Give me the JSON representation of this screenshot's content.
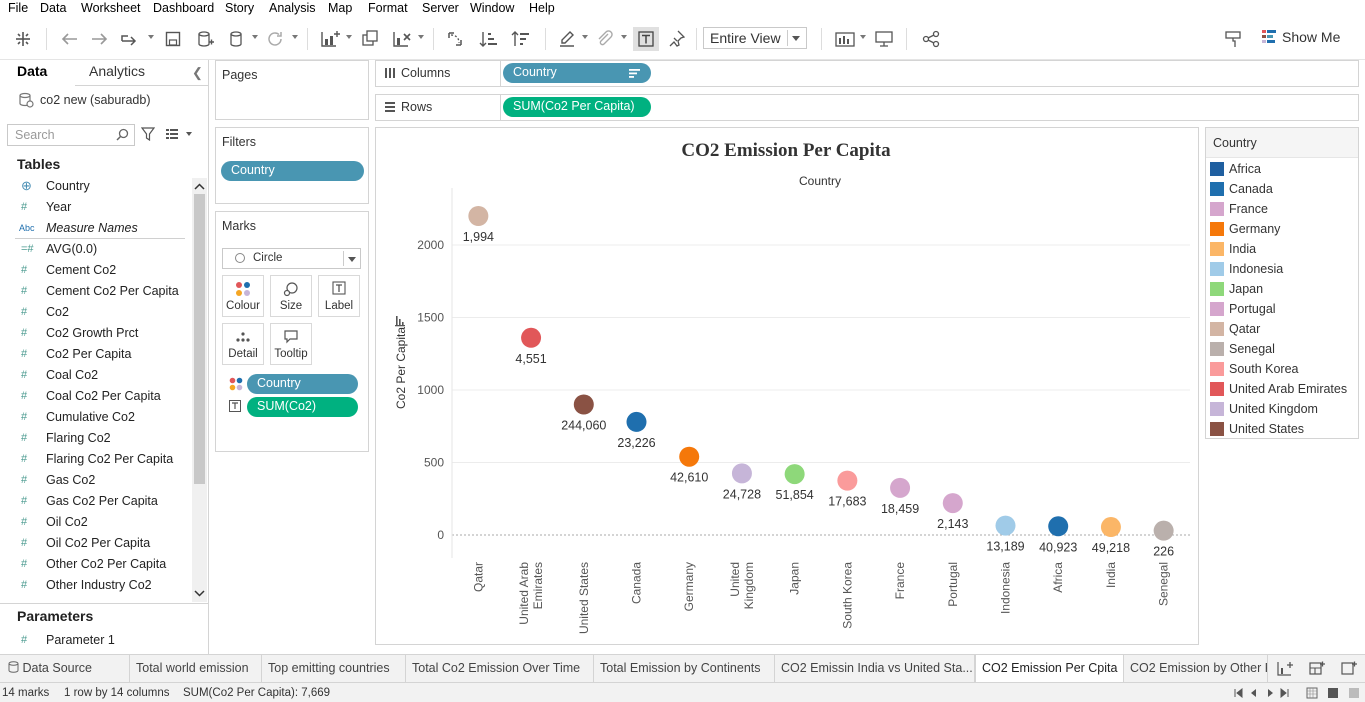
{
  "menu": [
    "File",
    "Data",
    "Worksheet",
    "Dashboard",
    "Story",
    "Analysis",
    "Map",
    "Format",
    "Server",
    "Window",
    "Help"
  ],
  "toolbar": {
    "view_select": "Entire View",
    "show_me": "Show Me",
    "icons": [
      "tableau-logo-icon",
      "undo-icon",
      "redo-icon",
      "replay-icon",
      "save-icon",
      "new-datasource-icon",
      "pause-update-icon",
      "refresh-icon",
      "new-worksheet-icon",
      "duplicate-sheet-icon",
      "clear-sheet-icon",
      "swap-icon",
      "sort-ascending-icon",
      "sort-descending-icon",
      "highlight-icon",
      "group-icon",
      "show-labels-icon",
      "pin-icon",
      "show-cards-icon",
      "presentation-icon",
      "share-icon",
      "format-icon"
    ]
  },
  "data_pane": {
    "tab_data": "Data",
    "tab_analytics": "Analytics",
    "datasource": "co2 new (saburadb)",
    "search_placeholder": "Search",
    "tables_heading": "Tables",
    "fields": [
      {
        "glyph": "⊕",
        "name": "Country",
        "italic": false
      },
      {
        "glyph": "#",
        "name": "Year",
        "italic": false
      },
      {
        "glyph": "Abc",
        "name": "Measure Names",
        "italic": true
      },
      {
        "glyph": "=#",
        "name": "AVG(0.0)",
        "italic": false
      },
      {
        "glyph": "#",
        "name": "Cement Co2",
        "italic": false
      },
      {
        "glyph": "#",
        "name": "Cement Co2 Per Capita",
        "italic": false
      },
      {
        "glyph": "#",
        "name": "Co2",
        "italic": false
      },
      {
        "glyph": "#",
        "name": "Co2 Growth Prct",
        "italic": false
      },
      {
        "glyph": "#",
        "name": "Co2 Per Capita",
        "italic": false
      },
      {
        "glyph": "#",
        "name": "Coal Co2",
        "italic": false
      },
      {
        "glyph": "#",
        "name": "Coal Co2 Per Capita",
        "italic": false
      },
      {
        "glyph": "#",
        "name": "Cumulative Co2",
        "italic": false
      },
      {
        "glyph": "#",
        "name": "Flaring Co2",
        "italic": false
      },
      {
        "glyph": "#",
        "name": "Flaring Co2 Per Capita",
        "italic": false
      },
      {
        "glyph": "#",
        "name": "Gas Co2",
        "italic": false
      },
      {
        "glyph": "#",
        "name": "Gas Co2 Per Capita",
        "italic": false
      },
      {
        "glyph": "#",
        "name": "Oil Co2",
        "italic": false
      },
      {
        "glyph": "#",
        "name": "Oil Co2 Per Capita",
        "italic": false
      },
      {
        "glyph": "#",
        "name": "Other Co2 Per Capita",
        "italic": false
      },
      {
        "glyph": "#",
        "name": "Other Industry Co2",
        "italic": false
      }
    ],
    "parameters_heading": "Parameters",
    "parameters": [
      {
        "glyph": "#",
        "name": "Parameter 1"
      }
    ]
  },
  "cards": {
    "pages_title": "Pages",
    "filters_title": "Filters",
    "filter_pill": "Country",
    "marks_title": "Marks",
    "mark_type": "Circle",
    "mark_buttons": [
      "Colour",
      "Size",
      "Label",
      "Detail",
      "Tooltip"
    ],
    "mark_pills": [
      {
        "name": "Country",
        "kind": "dim"
      },
      {
        "name": "SUM(Co2)",
        "kind": "meas"
      }
    ]
  },
  "shelves": {
    "columns_label": "Columns",
    "columns_pill": "Country",
    "rows_label": "Rows",
    "rows_pill": "SUM(Co2 Per Capita)"
  },
  "chart_data": {
    "type": "scatter",
    "title": "CO2 Emission Per Capita",
    "column_header": "Country",
    "ylabel": "Co2 Per Capita",
    "ylim": [
      -100,
      2350
    ],
    "yticks": [
      0,
      500,
      1000,
      1500,
      2000
    ],
    "grid": true,
    "categories": [
      "Qatar",
      "United Arab Emirates",
      "United States",
      "Canada",
      "Germany",
      "United Kingdom",
      "Japan",
      "South Korea",
      "France",
      "Portugal",
      "Indonesia",
      "Africa",
      "India",
      "Senegal"
    ],
    "category_labels": [
      "Qatar",
      "United Arab\nEmirates",
      "United States",
      "Canada",
      "Germany",
      "United\nKingdom",
      "Japan",
      "South Korea",
      "France",
      "Portugal",
      "Indonesia",
      "Africa",
      "India",
      "Senegal"
    ],
    "values": [
      2200,
      1360,
      900,
      780,
      540,
      425,
      420,
      375,
      325,
      220,
      65,
      60,
      55,
      30
    ],
    "point_labels": [
      "1,994",
      "4,551",
      "244,060",
      "23,226",
      "42,610",
      "24,728",
      "51,854",
      "17,683",
      "18,459",
      "2,143",
      "13,189",
      "40,923",
      "49,218",
      "226"
    ],
    "colors": [
      "#d3b5a4",
      "#e15759",
      "#8a5244",
      "#1f6fae",
      "#f5780a",
      "#c6b5d8",
      "#8ed87a",
      "#fa9b9b",
      "#d5a6cd",
      "#d5a6cd",
      "#a0cbe8",
      "#1f6fae",
      "#fbb667",
      "#bab0ac"
    ]
  },
  "legend": {
    "title": "Country",
    "items": [
      {
        "name": "Africa",
        "color": "#1f5fa0"
      },
      {
        "name": "Canada",
        "color": "#1f6fae"
      },
      {
        "name": "France",
        "color": "#d5a6cd"
      },
      {
        "name": "Germany",
        "color": "#f5780a"
      },
      {
        "name": "India",
        "color": "#fbb667"
      },
      {
        "name": "Indonesia",
        "color": "#a0cbe8"
      },
      {
        "name": "Japan",
        "color": "#8ed87a"
      },
      {
        "name": "Portugal",
        "color": "#d5a6cd"
      },
      {
        "name": "Qatar",
        "color": "#d3b5a4"
      },
      {
        "name": "Senegal",
        "color": "#bab0ac"
      },
      {
        "name": "South Korea",
        "color": "#fa9b9b"
      },
      {
        "name": "United Arab Emirates",
        "color": "#e15759"
      },
      {
        "name": "United Kingdom",
        "color": "#c6b5d8"
      },
      {
        "name": "United States",
        "color": "#8a5244"
      }
    ]
  },
  "sheet_tabs": [
    "Data Source",
    "Total world emission",
    "Top emitting countries",
    "Total Co2 Emission Over Time",
    "Total Emission by Continents",
    "CO2 Emissin India vs United Sta...",
    "CO2 Emission Per Cpita",
    "CO2 Emission by Other F"
  ],
  "active_tab": "CO2 Emission Per Cpita",
  "status": {
    "marks": "14 marks",
    "rows_cols": "1 row by 14 columns",
    "sum": "SUM(Co2 Per Capita): 7,669"
  }
}
